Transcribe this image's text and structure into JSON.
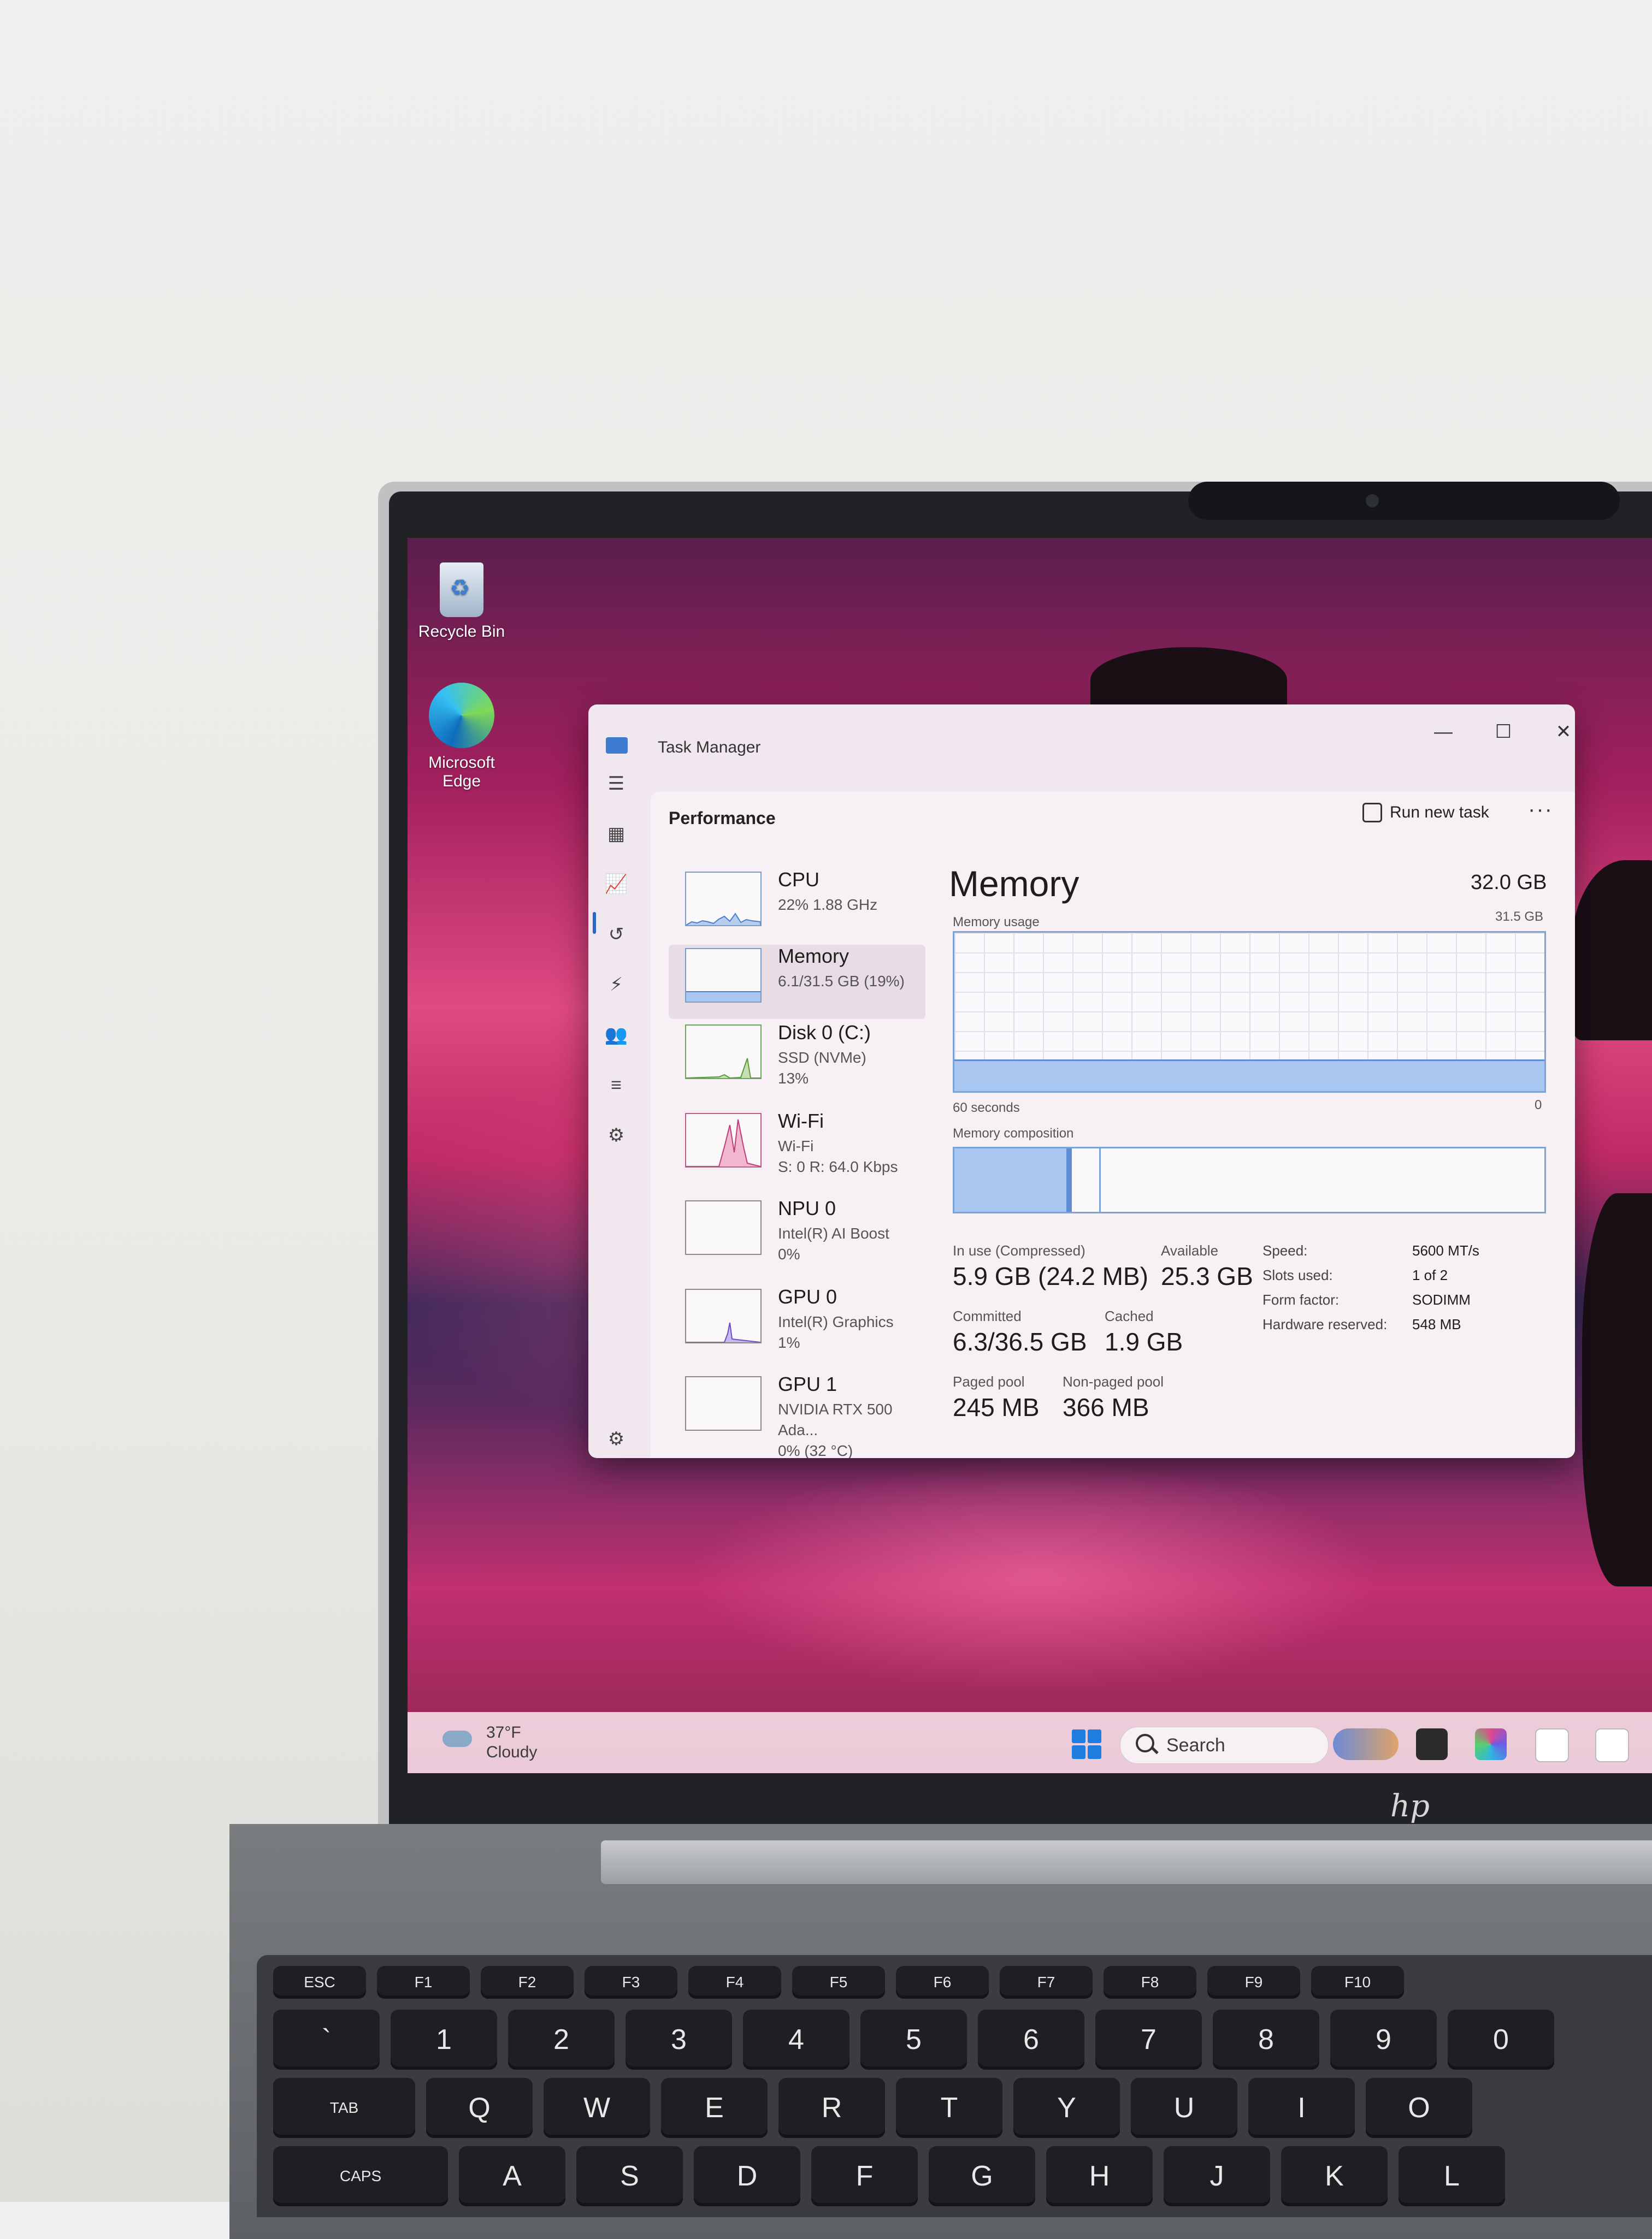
{
  "desktop": {
    "icons": [
      {
        "label": "Recycle Bin",
        "icon": "recycle-bin-icon"
      },
      {
        "label": "Microsoft\nEdge",
        "icon": "edge-icon"
      }
    ]
  },
  "taskbar": {
    "weather_temp": "37°F",
    "weather_desc": "Cloudy",
    "search_placeholder": "Search"
  },
  "task_manager": {
    "title": "Task Manager",
    "section": "Performance",
    "run_new_task": "Run new task",
    "more": "···",
    "resources": [
      {
        "name": "CPU",
        "sub": "22%  1.88 GHz"
      },
      {
        "name": "Memory",
        "sub": "6.1/31.5 GB (19%)"
      },
      {
        "name": "Disk 0 (C:)",
        "sub": "SSD (NVMe)\n13%"
      },
      {
        "name": "Wi-Fi",
        "sub": "Wi-Fi\nS: 0 R: 64.0 Kbps"
      },
      {
        "name": "NPU 0",
        "sub": "Intel(R) AI Boost\n0%"
      },
      {
        "name": "GPU 0",
        "sub": "Intel(R) Graphics\n1%"
      },
      {
        "name": "GPU 1",
        "sub": "NVIDIA RTX 500 Ada...\n0% (32 °C)"
      }
    ],
    "memory": {
      "title": "Memory",
      "total": "32.0 GB",
      "usage_label": "Memory usage",
      "usage_max": "31.5 GB",
      "time_left": "60 seconds",
      "time_right": "0",
      "composition_label": "Memory composition",
      "usage_fraction": 0.19,
      "in_use_label": "In use (Compressed)",
      "in_use_value": "5.9 GB (24.2 MB)",
      "available_label": "Available",
      "available_value": "25.3 GB",
      "committed_label": "Committed",
      "committed_value": "6.3/36.5 GB",
      "cached_label": "Cached",
      "cached_value": "1.9 GB",
      "paged_label": "Paged pool",
      "paged_value": "245 MB",
      "nonpaged_label": "Non-paged pool",
      "nonpaged_value": "366 MB",
      "specs": [
        {
          "k": "Speed:",
          "v": "5600 MT/s"
        },
        {
          "k": "Slots used:",
          "v": "1 of 2"
        },
        {
          "k": "Form factor:",
          "v": "SODIMM"
        },
        {
          "k": "Hardware reserved:",
          "v": "548 MB"
        }
      ]
    }
  },
  "keyboard": {
    "row_fn": [
      "esc",
      "f1",
      "f2",
      "f3",
      "f4",
      "f5",
      "f6",
      "f7",
      "f8",
      "f9",
      "f10"
    ],
    "row_num": [
      "`",
      "1",
      "2",
      "3",
      "4",
      "5",
      "6",
      "7",
      "8",
      "9",
      "0"
    ],
    "row_q": [
      "tab",
      "Q",
      "W",
      "E",
      "R",
      "T",
      "Y",
      "U",
      "I",
      "O"
    ],
    "row_a": [
      "caps",
      "A",
      "S",
      "D",
      "F",
      "G",
      "H",
      "J",
      "K",
      "L"
    ]
  },
  "brand": "hp"
}
